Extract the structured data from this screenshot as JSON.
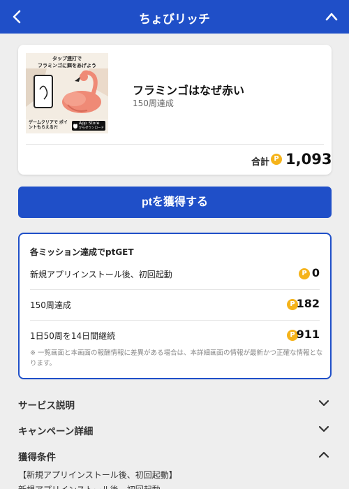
{
  "header": {
    "title": "ちょびリッチ",
    "bg": "#1f4fc8"
  },
  "offer": {
    "banner_caption_line1": "タップ連打で",
    "banner_caption_line2": "フラミンゴに餌をあげよう",
    "banner_footer": "ゲームクリアで ポイントもらえる?!",
    "store_badge_line1": "App Store",
    "store_badge_line2": "からダウンロード",
    "app_name": "フラミンゴはなぜ赤い",
    "subtitle": "150周達成",
    "total_label": "合計",
    "coin_symbol": "P",
    "total_points": "1,093"
  },
  "cta": {
    "label": "ptを獲得する"
  },
  "missions": {
    "title": "各ミッション達成でptGET",
    "rows": [
      {
        "label": "新規アプリインストール後、初回起動",
        "points": "0"
      },
      {
        "label": "150周達成",
        "points": "182"
      },
      {
        "label": "1日50周を14日間継続",
        "points": "911"
      }
    ],
    "note": "※ 一覧画面と本画面の報酬情報に差異がある場合は、本詳細画面の情報が最新かつ正確な情報となります。"
  },
  "sections": [
    {
      "label": "サービス説明",
      "expanded": false
    },
    {
      "label": "キャンペーン詳細",
      "expanded": false
    },
    {
      "label": "獲得条件",
      "expanded": true
    }
  ],
  "conditions": {
    "line1": "【新規アプリインストール後、初回起動】",
    "line2": "新規アプリインストール後、初回起動"
  },
  "colors": {
    "accent": "#1f4fc8",
    "coin": "#f5b31a",
    "background": "#eeeeee"
  },
  "icons": {
    "back": "chevron-left-icon",
    "collapse": "chevron-up-icon",
    "coin": "point-coin-icon",
    "expand": "chevron-down-icon"
  }
}
